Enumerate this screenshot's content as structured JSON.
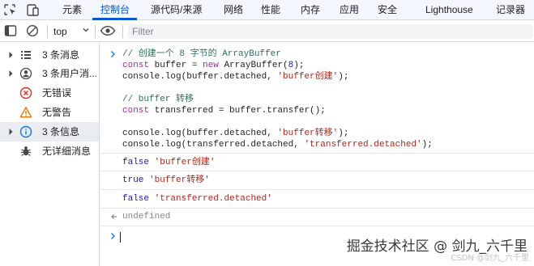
{
  "tabs": [
    {
      "label": "元素"
    },
    {
      "label": "控制台"
    },
    {
      "label": "源代码/来源"
    },
    {
      "label": "网络"
    },
    {
      "label": "性能"
    },
    {
      "label": "内存"
    },
    {
      "label": "应用"
    },
    {
      "label": "安全"
    },
    {
      "label": "Lighthouse"
    },
    {
      "label": "记录器"
    }
  ],
  "active_tab": "控制台",
  "toolbar": {
    "context": "top",
    "filter_placeholder": "Filter"
  },
  "sidebar": {
    "selected_index": 4,
    "items": [
      {
        "label": "3 条消息",
        "icon": "list-icon"
      },
      {
        "label": "3 条用户消...",
        "icon": "user-icon"
      },
      {
        "label": "无错误",
        "icon": "error-icon"
      },
      {
        "label": "无警告",
        "icon": "warning-icon"
      },
      {
        "label": "3 条信息",
        "icon": "info-icon"
      },
      {
        "label": "无详细消息",
        "icon": "bug-icon"
      }
    ]
  },
  "console": {
    "code": {
      "line1": "// 创建一个 8 字节的 ArrayBuffer",
      "line2_kw": "const",
      "line2_var": " buffer = ",
      "line2_new": "new",
      "line2_rest": " ArrayBuffer(",
      "line2_num": "8",
      "line2_end": ");",
      "line3_pre": "console.log(buffer.detached, ",
      "line3_str": "'buffer创建'",
      "line3_end": ");",
      "line4": "// buffer 转移",
      "line5_kw": "const",
      "line5_rest": " transferred = buffer.transfer();",
      "line6_pre": "console.log(buffer.detached, ",
      "line6_str": "'buffer转移'",
      "line6_end": ");",
      "line7_pre": "console.log(transferred.detached, ",
      "line7_str": "'transferred.detached'",
      "line7_end": ");"
    },
    "outputs": [
      {
        "bool": "false",
        "str": "'buffer创建'"
      },
      {
        "bool": "true",
        "str": "'buffer转移'"
      },
      {
        "bool": "false",
        "str": "'transferred.detached'"
      }
    ],
    "return_value": "undefined"
  },
  "watermark": {
    "main": "掘金技术社区 @ 剑九_六千里",
    "sub": "CSDN @剑九_六千里"
  }
}
